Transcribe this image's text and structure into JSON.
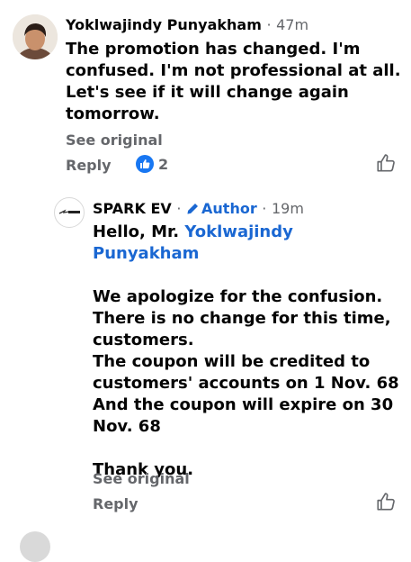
{
  "comment": {
    "author": "Yoklwajindy Punyakham",
    "separator": "·",
    "time": "47m",
    "text": "The promotion has changed. I'm confused. I'm not professional at all. Let's see if it will change again tomorrow.",
    "see_original": "See original",
    "reply_label": "Reply",
    "reaction_count": "2",
    "reaction_icon": "like-icon",
    "like_button_icon": "thumbs-up-outline-icon"
  },
  "reply": {
    "author": "SPARK EV",
    "separator1": "·",
    "author_badge": "Author",
    "separator2": "·",
    "time": "19m",
    "greeting_prefix": "Hello, Mr. ",
    "mention": "Yoklwajindy Punyakham",
    "text": "We apologize for the confusion. There is no change for this time, customers.\nThe coupon will be credited to customers' accounts on 1 Nov. 68\nAnd the coupon will expire on 30 Nov. 68\n\nThank you.",
    "see_original": "See original",
    "reply_label": "Reply",
    "like_button_icon": "thumbs-up-outline-icon"
  },
  "colors": {
    "text": "#050505",
    "secondary": "#65676b",
    "link": "#1a67d2",
    "like_blue": "#1877f2"
  }
}
